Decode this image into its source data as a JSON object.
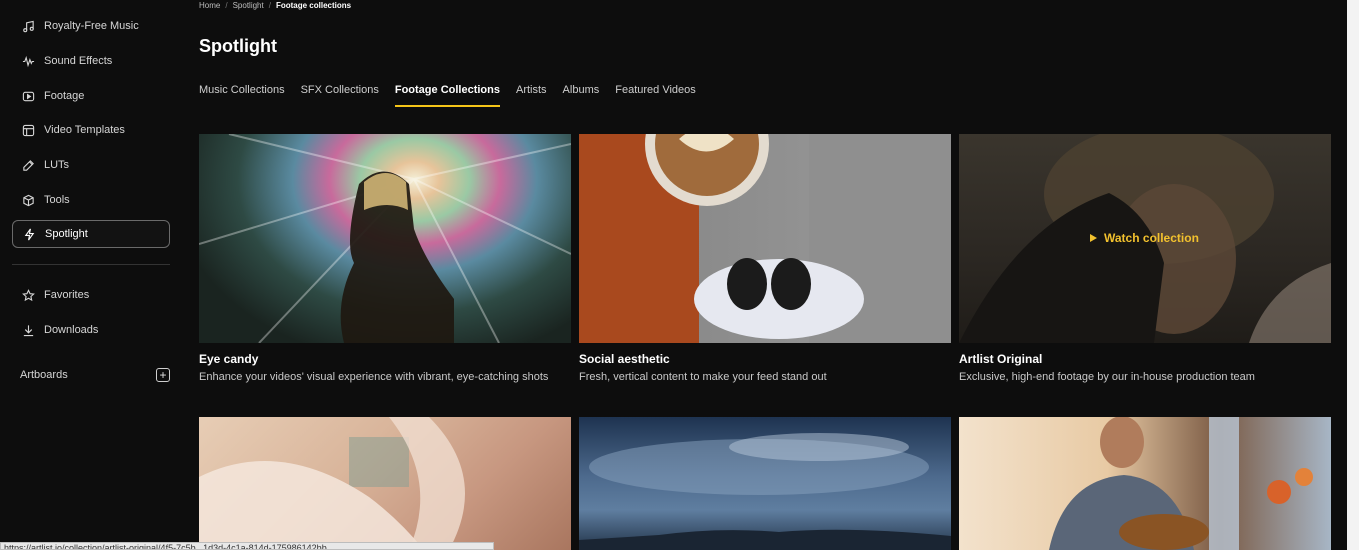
{
  "sidebar": {
    "items": [
      {
        "label": "Royalty-Free Music",
        "icon": "music-note-icon"
      },
      {
        "label": "Sound Effects",
        "icon": "waveform-icon"
      },
      {
        "label": "Footage",
        "icon": "play-square-icon"
      },
      {
        "label": "Video Templates",
        "icon": "template-icon"
      },
      {
        "label": "LUTs",
        "icon": "eyedropper-icon"
      },
      {
        "label": "Tools",
        "icon": "box-icon"
      },
      {
        "label": "Spotlight",
        "icon": "lightning-icon",
        "active": true
      }
    ],
    "secondary": [
      {
        "label": "Favorites",
        "icon": "star-icon"
      },
      {
        "label": "Downloads",
        "icon": "download-icon"
      }
    ],
    "artboards_label": "Artboards",
    "artboards_add": "+"
  },
  "breadcrumb": {
    "home": "Home",
    "spotlight": "Spotlight",
    "current": "Footage collections"
  },
  "page_title": "Spotlight",
  "tabs": [
    {
      "label": "Music Collections"
    },
    {
      "label": "SFX Collections"
    },
    {
      "label": "Footage Collections",
      "active": true
    },
    {
      "label": "Artists"
    },
    {
      "label": "Albums"
    },
    {
      "label": "Featured Videos"
    }
  ],
  "cards": [
    {
      "title": "Eye candy",
      "description": "Enhance your videos' visual experience with vibrant, eye-catching shots"
    },
    {
      "title": "Social aesthetic",
      "description": "Fresh, vertical content to make your feed stand out"
    },
    {
      "title": "Artlist Original",
      "description": "Exclusive, high-end footage by our in-house production team",
      "hover_label": "Watch collection"
    }
  ],
  "status_url": "https://artlist.io/collection/artlist-original/4f5-7c5b...1d3d-4c1a-814d-175986142bb",
  "colors": {
    "background": "#0d0d0d",
    "accent": "#f5c518",
    "watch_label": "#f2c12e"
  }
}
